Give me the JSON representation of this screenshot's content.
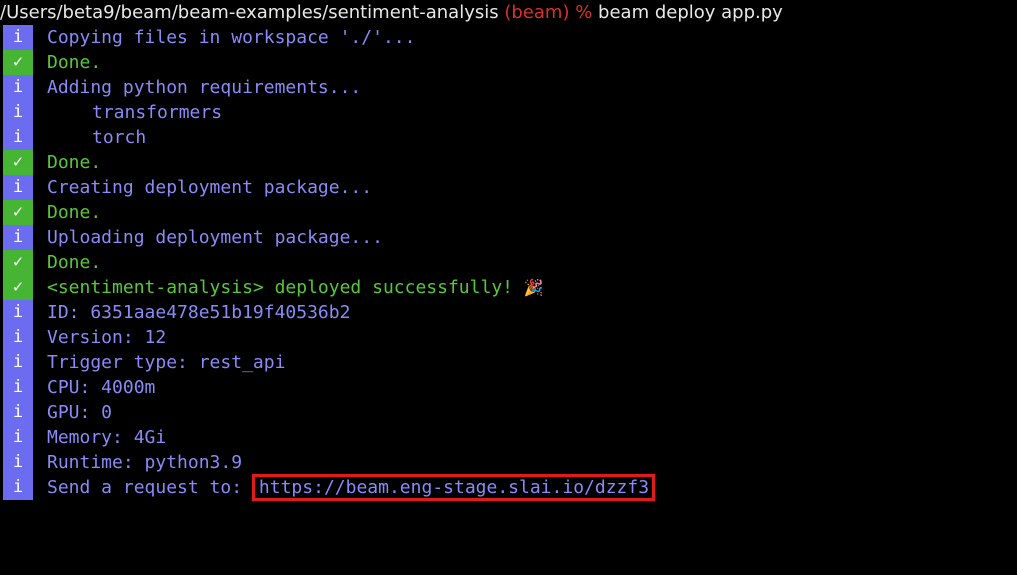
{
  "prompt": {
    "path": "/Users/beta9/beam/beam-examples/sentiment-analysis",
    "env": "(beam)",
    "symbol": "%",
    "command": "beam deploy app.py"
  },
  "badges": {
    "info": "i",
    "ok": "✓"
  },
  "lines": [
    {
      "kind": "info",
      "text": "Copying files in workspace './'..."
    },
    {
      "kind": "ok",
      "text": "Done."
    },
    {
      "kind": "info",
      "text": "Adding python requirements..."
    },
    {
      "kind": "info",
      "text": "transformers"
    },
    {
      "kind": "info",
      "text": "torch"
    },
    {
      "kind": "ok",
      "text": "Done."
    },
    {
      "kind": "info",
      "text": "Creating deployment package..."
    },
    {
      "kind": "ok",
      "text": "Done."
    },
    {
      "kind": "info",
      "text": "Uploading deployment package..."
    },
    {
      "kind": "ok",
      "text": "Done."
    },
    {
      "kind": "ok",
      "text": "<sentiment-analysis> deployed successfully!",
      "emoji": "🎉"
    },
    {
      "kind": "info",
      "text": "ID: 6351aae478e51b19f40536b2"
    },
    {
      "kind": "info",
      "text": "Version: 12"
    },
    {
      "kind": "info",
      "text": "Trigger type: rest_api"
    },
    {
      "kind": "info",
      "text": "CPU: 4000m"
    },
    {
      "kind": "info",
      "text": "GPU: 0"
    },
    {
      "kind": "info",
      "text": "Memory: 4Gi"
    },
    {
      "kind": "info",
      "text": "Runtime: python3.9"
    },
    {
      "kind": "info",
      "text": "Send a request to:",
      "url": "https://beam.eng-stage.slai.io/dzzf3"
    }
  ],
  "colors": {
    "background": "#000000",
    "info_badge": "#6c6cf0",
    "ok_badge": "#46b534",
    "info_text": "#8a8af8",
    "ok_text": "#58c83a",
    "env_text": "#d9322a",
    "highlight_box": "#e11a1a"
  }
}
